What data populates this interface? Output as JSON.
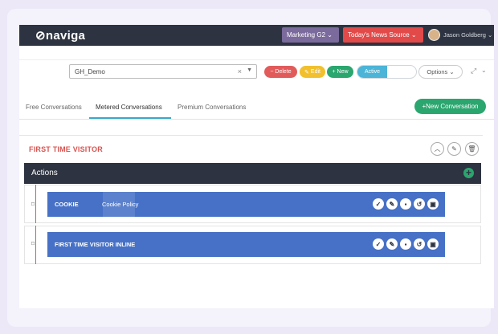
{
  "topbar": {
    "logo": "⊘naviga",
    "marketing": "Marketing G2 ⌄",
    "news_source": "Today's News Source ⌄",
    "user": "Jason Goldberg ⌄"
  },
  "toolbar": {
    "select_value": "GH_Demo",
    "delete_label": "Delete",
    "edit_label": "Edit",
    "new_label": "New",
    "active_label": "Active",
    "options_label": "Options ⌄"
  },
  "tabs": [
    {
      "label": "Free Conversations"
    },
    {
      "label": "Metered Conversations",
      "active": true
    },
    {
      "label": "Premium Conversations"
    }
  ],
  "new_conversation_label": "New Conversation",
  "section": {
    "title": "FIRST TIME VISITOR",
    "actions_label": "Actions"
  },
  "actions": [
    {
      "name": "COOKIE",
      "extra": "Cookie Policy"
    },
    {
      "name": "FIRST TIME VISITOR INLINE",
      "extra": ""
    }
  ],
  "colors": {
    "topbar": "#2d3340",
    "marketing": "#7b6a9c",
    "news": "#e24a4a",
    "green": "#2aa66e",
    "card": "#4671c6",
    "section_title": "#d9534f"
  }
}
